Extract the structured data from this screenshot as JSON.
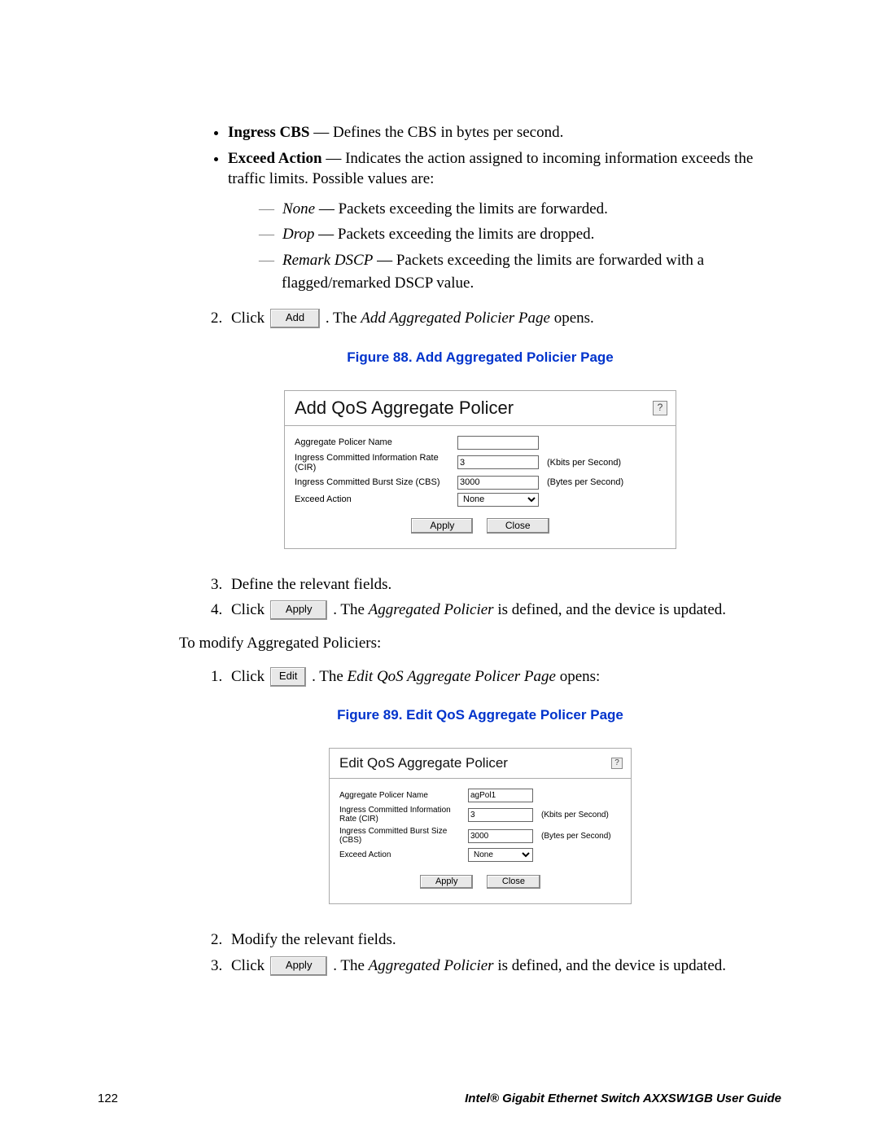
{
  "bullets": {
    "b1_term": "Ingress CBS",
    "b1_text": " — Defines the CBS in bytes per second.",
    "b2_term": "Exceed Action",
    "b2_text": " — Indicates the action assigned to incoming information exceeds the traffic limits. Possible values are:"
  },
  "sub": {
    "s1_term": "None",
    "s1_text": " — Packets exceeding the limits are forwarded.",
    "s2_term": "Drop",
    "s2_text": " — Packets exceeding the limits are dropped.",
    "s3_term": "Remark DSCP",
    "s3_text": " — Packets exceeding the limits are forwarded with a flagged/remarked DSCP value."
  },
  "steps": {
    "click": "Click ",
    "btn_add": "Add",
    "s2_after_a": ". The ",
    "s2_it": "Add Aggregated Policier Page",
    "s2_after_b": " opens.",
    "s3": "Define the relevant fields.",
    "btn_apply": "Apply",
    "s4_after_a": ". The ",
    "s4_it": "Aggregated Policier",
    "s4_after_b": " is defined, and the device is updated.",
    "modify_intro": "To modify Aggregated Policiers:",
    "btn_edit": "Edit",
    "m1_after_a": ". The ",
    "m1_it": "Edit QoS Aggregate Policer Page",
    "m1_after_b": " opens:",
    "m2": "Modify the relevant fields."
  },
  "figcap1": "Figure 88. Add Aggregated Policier Page",
  "figcap2": "Figure 89. Edit QoS Aggregate Policer Page",
  "dlg_add": {
    "title": "Add QoS Aggregate Policer",
    "f_name_lbl": "Aggregate Policer Name",
    "f_name_val": "",
    "f_cir_lbl": "Ingress Committed Information Rate (CIR)",
    "f_cir_val": "3",
    "f_cir_unit": "(Kbits per Second)",
    "f_cbs_lbl": "Ingress Committed Burst Size (CBS)",
    "f_cbs_val": "3000",
    "f_cbs_unit": "(Bytes per Second)",
    "f_act_lbl": "Exceed Action",
    "f_act_val": "None",
    "btn_apply": "Apply",
    "btn_close": "Close"
  },
  "dlg_edit": {
    "title": "Edit QoS Aggregate Policer",
    "f_name_lbl": "Aggregate Policer Name",
    "f_name_val": "agPol1",
    "f_cir_lbl": "Ingress Committed Information Rate (CIR)",
    "f_cir_val": "3",
    "f_cir_unit": "(Kbits per Second)",
    "f_cbs_lbl": "Ingress Committed Burst Size (CBS)",
    "f_cbs_val": "3000",
    "f_cbs_unit": "(Bytes per Second)",
    "f_act_lbl": "Exceed Action",
    "f_act_val": "None",
    "btn_apply": "Apply",
    "btn_close": "Close"
  },
  "footer": {
    "page": "122",
    "doc": "Intel® Gigabit Ethernet Switch AXXSW1GB User Guide"
  }
}
